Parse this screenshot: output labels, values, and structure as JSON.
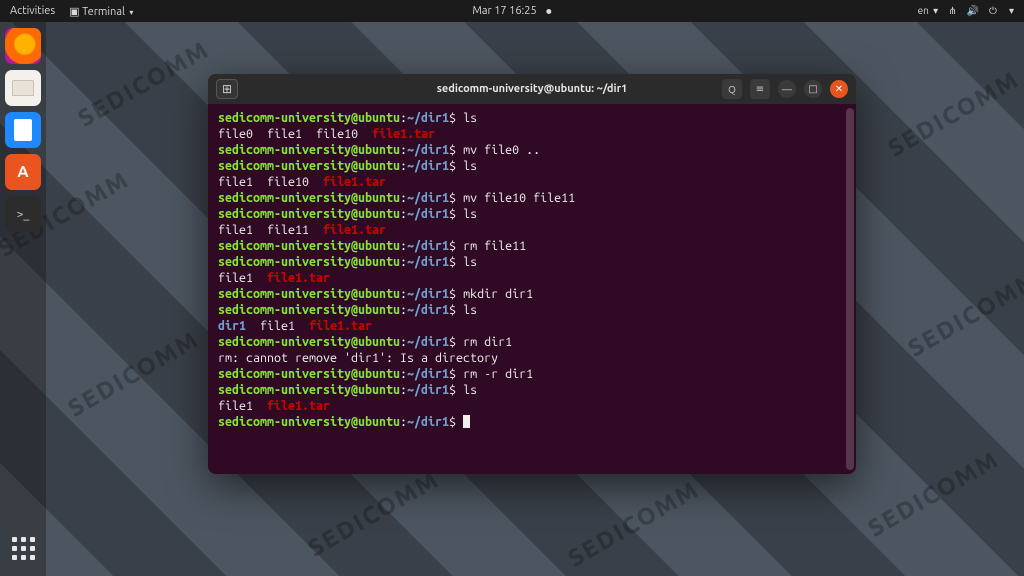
{
  "topbar": {
    "activities": "Activities",
    "appmenu": "Terminal",
    "datetime": "Mar 17  16:25",
    "lang": "en"
  },
  "window": {
    "title": "sedicomm-university@ubuntu: ~/dir1"
  },
  "prompt": {
    "user": "sedicomm-university@ubuntu",
    "sep": ":",
    "path": "~/dir1",
    "sigil": "$"
  },
  "files": {
    "file0": "file0",
    "file1": "file1",
    "file10": "file10",
    "file11": "file11",
    "tar": "file1.tar",
    "dir1": "dir1"
  },
  "cmd": {
    "ls": "ls",
    "mv_up": "mv file0 ..",
    "mv_ren": "mv file10 file11",
    "rm_f": "rm file11",
    "mkdir": "mkdir dir1",
    "rm_dir": "rm dir1",
    "rm_r": "rm -r dir1"
  },
  "msg": {
    "rmdir_err": "rm: cannot remove 'dir1': Is a directory"
  },
  "wm": {
    "text": "SEDICOMM"
  }
}
